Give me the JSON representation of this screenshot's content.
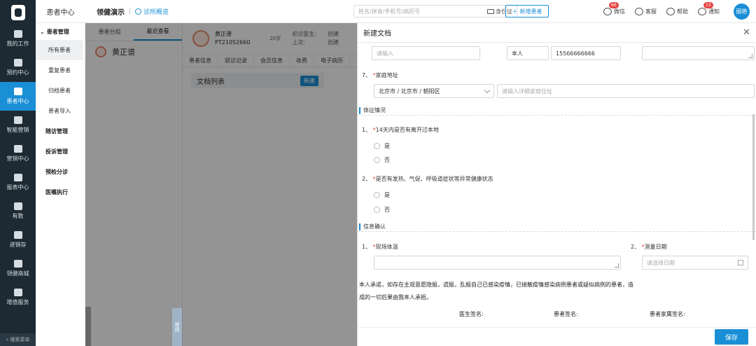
{
  "leftnav": {
    "items": [
      {
        "label": "我的工作",
        "icon": "chart-icon"
      },
      {
        "label": "预约中心",
        "icon": "calendar-icon"
      },
      {
        "label": "患者中心",
        "icon": "user-icon"
      },
      {
        "label": "智能营销",
        "icon": "target-icon"
      },
      {
        "label": "营销中心",
        "icon": "flower-icon"
      },
      {
        "label": "报表中心",
        "icon": "bar-chart-icon"
      },
      {
        "label": "有数",
        "icon": "graph-icon"
      },
      {
        "label": "进销存",
        "icon": "layers-icon"
      },
      {
        "label": "领健商城",
        "icon": "shop-icon"
      },
      {
        "label": "增值服务",
        "icon": "grid-icon"
      }
    ],
    "search_label": "搜索菜单"
  },
  "topbar": {
    "module": "患者中心",
    "title": "领健演示",
    "home_link": "诊所概览",
    "search_placeholder": "姓名/拼音/手机号/病历号",
    "idcard_label": "身份证",
    "new_patient": "新增患者",
    "tools": [
      {
        "label": "微信",
        "badge": "66",
        "icon": "wechat-icon"
      },
      {
        "label": "客服",
        "badge": "",
        "icon": "headset-icon"
      },
      {
        "label": "帮助",
        "badge": "",
        "icon": "help-icon"
      },
      {
        "label": "通知",
        "badge": "13",
        "icon": "bell-icon"
      }
    ],
    "avatar_text": "丽艳"
  },
  "subnav": {
    "group": "患者管理",
    "items": [
      "所有患者",
      "重复患者",
      "归档患者",
      "患者导入"
    ],
    "others": [
      "随访管理",
      "投诉管理",
      "预检分诊",
      "医嘱执行"
    ]
  },
  "background": {
    "list_tabs": [
      "患者分组",
      "最近查看"
    ],
    "patient": "黄正谱",
    "patient_id": "PT21052660",
    "patient_tags": "20岁",
    "meta1": "初诊医生:",
    "meta2": "上次:",
    "meta3": "创建",
    "meta4": "创建",
    "detail_tabs": [
      "患者信息",
      "就诊记录",
      "会员信息",
      "收费",
      "电子病历"
    ],
    "doc_list": "文档列表",
    "doc_new": "新建",
    "side_tab": "常用"
  },
  "drawer": {
    "title": "新建文档",
    "top_row": {
      "name_placeholder": "请输入",
      "relation": "本人",
      "phone": "15566666666"
    },
    "q7": {
      "num": "7、",
      "label": "家庭地址",
      "region": "北京市 / 北京市 / 朝阳区",
      "detail_placeholder": "请输入详细家庭住址"
    },
    "section1": "体征情况",
    "q1": {
      "num": "1、",
      "label": "14天内是否有离开过本地",
      "options": [
        "是",
        "否"
      ]
    },
    "q2": {
      "num": "2、",
      "label": "是否有发热、气促、呼吸道症状等异常健康状态",
      "options": [
        "是",
        "否"
      ]
    },
    "section2": "信息确认",
    "c1": {
      "num": "1、",
      "label": "现场体温"
    },
    "c2": {
      "num": "2、",
      "label": "测量日期",
      "placeholder": "请选择日期"
    },
    "promise_1": "本人承诺，如存在主观意愿隐报，谎报，乱报自己已感染疫情，已接触疫情感染病例患者或疑似病例的患者，造",
    "promise_2": "成的一切后果由我本人承担。",
    "signs": [
      "医生签名:",
      "患者签名:",
      "患者家属签名:"
    ],
    "save": "保存"
  }
}
